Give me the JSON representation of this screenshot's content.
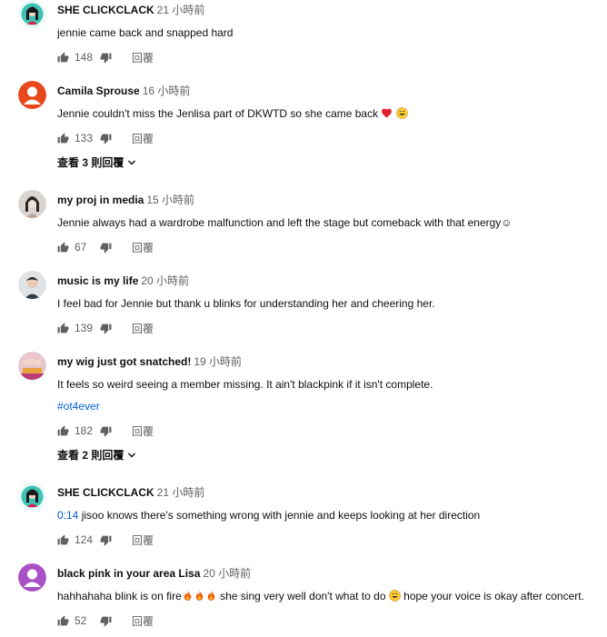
{
  "comments": [
    {
      "author": "SHE CLICKCLACK",
      "time": "21 小時前",
      "text": "jennie came back and snapped hard",
      "likes": "148",
      "reply": "回覆",
      "avatar_icon": "girl-avatar-teal"
    },
    {
      "author": "Camila Sprouse",
      "time": "16 小時前",
      "text": "Jennie couldn't miss the Jenlisa part of DKWTD so she came back",
      "likes": "133",
      "reply": "回覆",
      "view_replies": "查看 3 則回覆",
      "avatar_icon": "orange-person-avatar"
    },
    {
      "author": "my proj in media",
      "time": "15 小時前",
      "text": "Jennie always had a wardrobe malfunction and left the stage but comeback with that energy☺",
      "likes": "67",
      "reply": "回覆",
      "avatar_icon": "photo-avatar-girl"
    },
    {
      "author": "music is my life",
      "time": "20 小時前",
      "text": "I feel bad for Jennie but thank u blinks for understanding her and cheering her.",
      "likes": "139",
      "reply": "回覆",
      "avatar_icon": "photo-avatar-boy"
    },
    {
      "author": "my wig just got snatched!",
      "time": "19 小時前",
      "text": "It feels so weird seeing a member missing. It ain't blackpink if it isn't complete.",
      "hashtag": "#ot4ever",
      "likes": "182",
      "reply": "回覆",
      "view_replies": "查看 2 則回覆",
      "avatar_icon": "group-photo-avatar"
    },
    {
      "author": "SHE CLICKCLACK",
      "time": "21 小時前",
      "timestamp_link": "0:14",
      "text": " jisoo knows there's something wrong with jennie and keeps looking at her direction",
      "likes": "124",
      "reply": "回覆",
      "avatar_icon": "girl-avatar-teal"
    },
    {
      "author": "black pink in your area Lisa",
      "time": "20 小時前",
      "text_a": "hahhahaha blink is on fire",
      "text_b": " she sing very well don't what to do ",
      "text_c": " hope your voice is okay after concert.",
      "likes": "52",
      "reply": "回覆",
      "avatar_icon": "purple-person-avatar"
    }
  ]
}
